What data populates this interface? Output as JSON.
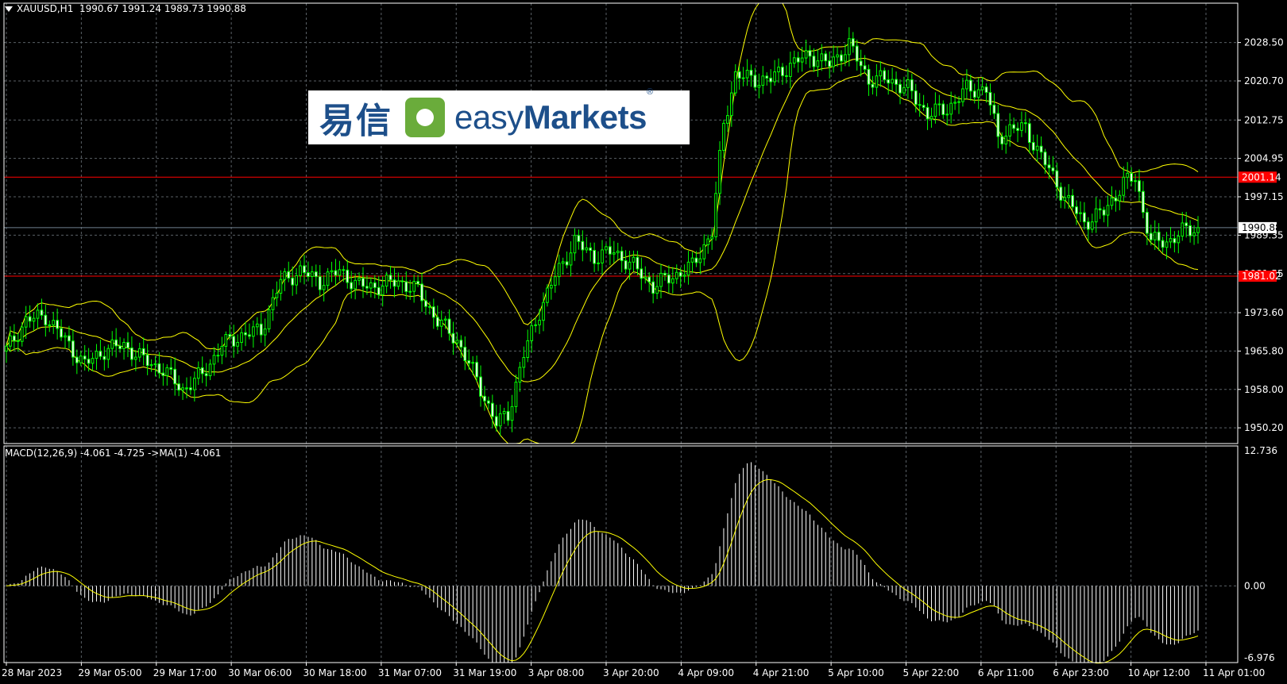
{
  "header": {
    "symbol": "XAUUSD,H1",
    "ohlc": "1990.67 1991.24 1989.73 1990.88"
  },
  "macd_header": {
    "label": "MACD(12,26,9) -4.061 -4.725 ->MA(1) -4.061"
  },
  "logo": {
    "cn_text": "易信",
    "en_text_light": "easy",
    "en_text_bold": "Markets",
    "registered": "®",
    "icon": "easymarkets-logo-icon"
  },
  "colors": {
    "bull_candle": "#00ff00",
    "bear_candle": "#ffffff",
    "bollinger": "#ffff00",
    "grid": "#5a6066",
    "horizontal_line": "#ff0000",
    "current_price_line": "#708090",
    "macd_hist": "#ffffff",
    "macd_signal": "#ffff00"
  },
  "chart_data": [
    {
      "type": "candlestick",
      "name": "XAUUSD,H1",
      "y_ticks": [
        "2028.50",
        "2020.70",
        "2012.75",
        "2004.95",
        "1997.15",
        "1989.35",
        "1981.55",
        "1973.60",
        "1965.80",
        "1958.00",
        "1950.20"
      ],
      "ylim": [
        1947.0,
        2036.5
      ],
      "x_ticks": [
        "28 Mar 2023",
        "29 Mar 05:00",
        "29 Mar 17:00",
        "30 Mar 06:00",
        "30 Mar 18:00",
        "31 Mar 07:00",
        "31 Mar 19:00",
        "3 Apr 08:00",
        "3 Apr 20:00",
        "4 Apr 09:00",
        "4 Apr 21:00",
        "5 Apr 10:00",
        "5 Apr 22:00",
        "6 Apr 11:00",
        "6 Apr 23:00",
        "10 Apr 12:00",
        "11 Apr 01:00"
      ],
      "horizontal_lines": [
        {
          "label": "2001.14",
          "value": 2001.14
        },
        {
          "label": "1981.02",
          "value": 1981.02
        }
      ],
      "current_price": {
        "label": "1990.88",
        "value": 1990.88
      },
      "close_anchors": [
        [
          0,
          1966
        ],
        [
          5,
          1972
        ],
        [
          10,
          1973
        ],
        [
          15,
          1968
        ],
        [
          20,
          1963
        ],
        [
          25,
          1966
        ],
        [
          30,
          1967
        ],
        [
          35,
          1964
        ],
        [
          40,
          1962
        ],
        [
          45,
          1958
        ],
        [
          50,
          1961
        ],
        [
          55,
          1967
        ],
        [
          60,
          1969
        ],
        [
          65,
          1970
        ],
        [
          70,
          1980
        ],
        [
          75,
          1982
        ],
        [
          80,
          1980
        ],
        [
          85,
          1982
        ],
        [
          90,
          1979
        ],
        [
          95,
          1979
        ],
        [
          100,
          1980
        ],
        [
          105,
          1978
        ],
        [
          110,
          1972
        ],
        [
          115,
          1968
        ],
        [
          120,
          1960
        ],
        [
          125,
          1951
        ],
        [
          128,
          1953
        ],
        [
          132,
          1965
        ],
        [
          136,
          1974
        ],
        [
          140,
          1981
        ],
        [
          145,
          1988
        ],
        [
          150,
          1985
        ],
        [
          155,
          1986
        ],
        [
          160,
          1983
        ],
        [
          165,
          1979
        ],
        [
          170,
          1981
        ],
        [
          175,
          1983
        ],
        [
          180,
          1990
        ],
        [
          183,
          2012
        ],
        [
          186,
          2022
        ],
        [
          190,
          2021
        ],
        [
          195,
          2021
        ],
        [
          200,
          2024
        ],
        [
          205,
          2026
        ],
        [
          210,
          2024
        ],
        [
          215,
          2028
        ],
        [
          220,
          2021
        ],
        [
          225,
          2021
        ],
        [
          230,
          2019
        ],
        [
          235,
          2014
        ],
        [
          240,
          2015
        ],
        [
          245,
          2019
        ],
        [
          250,
          2019
        ],
        [
          253,
          2009
        ],
        [
          256,
          2011
        ],
        [
          260,
          2011
        ],
        [
          265,
          2004
        ],
        [
          270,
          1997
        ],
        [
          275,
          1992
        ],
        [
          280,
          1994
        ],
        [
          285,
          2000
        ],
        [
          288,
          2001
        ],
        [
          292,
          1988
        ],
        [
          296,
          1988
        ],
        [
          300,
          1990
        ],
        [
          304,
          1990.88
        ]
      ],
      "bollinger_bands": {
        "period": 20,
        "deviations": 2
      }
    },
    {
      "type": "macd",
      "name": "MACD(12,26,9)",
      "y_ticks": [
        "12.736",
        "0.00",
        "-6.976"
      ],
      "ylim": [
        -6.976,
        12.736
      ],
      "values": {
        "macd": -4.061,
        "signal": -4.725,
        "ma": -4.061
      }
    }
  ]
}
